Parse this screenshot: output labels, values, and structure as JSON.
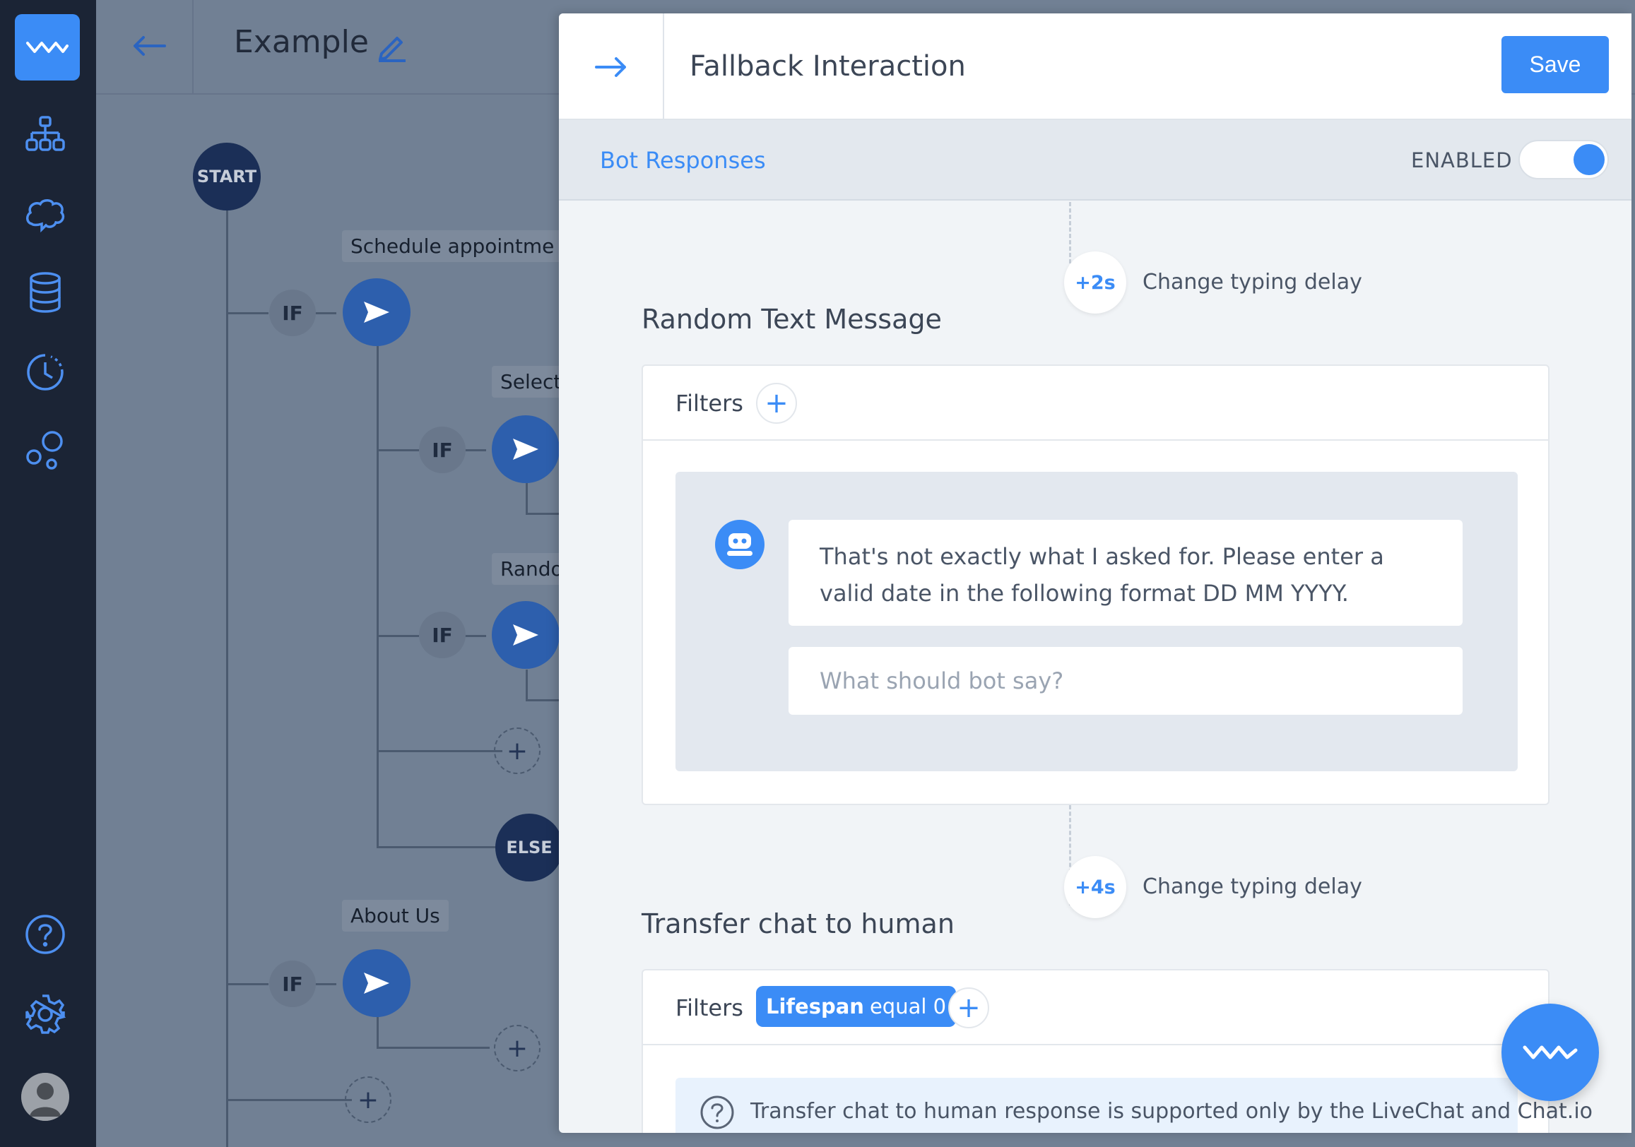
{
  "app": {
    "brand_icon": "logo-wave-icon",
    "nav_icons": [
      "flow-tree-icon",
      "brain-icon",
      "database-icon",
      "history-icon",
      "bubbles-icon"
    ],
    "bottom_icons": [
      "help-icon",
      "settings-icon"
    ]
  },
  "flow": {
    "title": "Example",
    "nodes": {
      "start": "START",
      "if": "IF",
      "else": "ELSE"
    },
    "tags": {
      "schedule": "Schedule appointme",
      "select": "Select",
      "random": "Rando",
      "about": "About Us"
    }
  },
  "panel": {
    "title": "Fallback Interaction",
    "save_label": "Save",
    "tab_label": "Bot Responses",
    "enabled_label": "ENABLED",
    "enabled": true,
    "responses": [
      {
        "delay": "+2s",
        "delay_label": "Change typing delay",
        "title": "Random Text Message",
        "filters_label": "Filters",
        "message": "That's not exactly what I asked for. Please enter a valid date in the following format DD MM YYYY.",
        "input_placeholder": "What should bot say?"
      },
      {
        "delay": "+4s",
        "delay_label": "Change typing delay",
        "title": "Transfer chat to human",
        "filters_label": "Filters",
        "filter": {
          "name": "Lifespan",
          "condition": "equal 0"
        },
        "info": "Transfer chat to human response is supported only by the LiveChat and Chat.io"
      }
    ]
  },
  "colors": {
    "accent": "#3b8cf6",
    "sidebar": "#1b2435",
    "overlay": "#718094"
  }
}
